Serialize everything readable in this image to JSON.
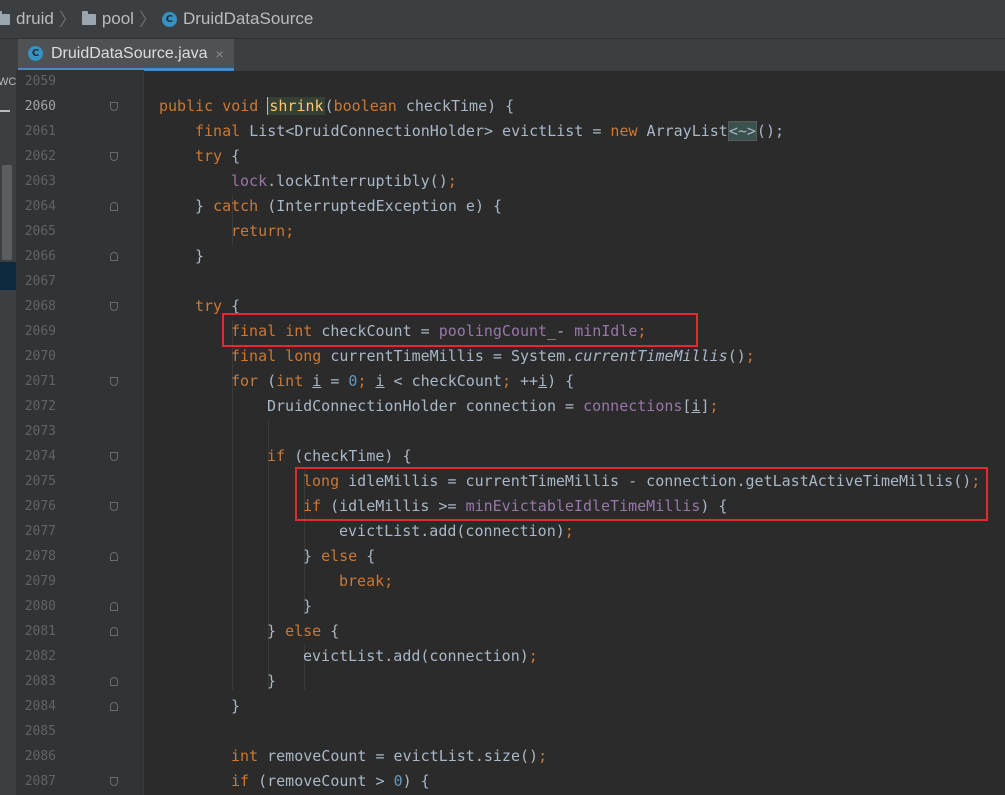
{
  "breadcrumb": {
    "items": [
      "druid",
      "pool",
      "DruidDataSource"
    ]
  },
  "tab": {
    "label": "DruidDataSource.java",
    "close": "×"
  },
  "side": {
    "label": "WC"
  },
  "icons": {
    "class_icon_letter": "C"
  },
  "colors": {
    "keyword": "#cc7832",
    "field": "#9876aa",
    "number": "#6897bb",
    "method_decl": "#ffc66d",
    "text": "#a9b7c6",
    "highlight_box": "#e02c2c",
    "background": "#2b2b2b"
  },
  "editor": {
    "current_line": "2060",
    "lines": [
      {
        "num": "2059",
        "t": []
      },
      {
        "num": "2060",
        "t": [
          [
            "kw",
            "public "
          ],
          [
            "kw",
            "void "
          ],
          [
            "fn",
            "shrink"
          ],
          [
            "",
            "("
          ],
          [
            "kw",
            "boolean "
          ],
          [
            "",
            "checkTime) {"
          ]
        ]
      },
      {
        "num": "2061",
        "t": [
          [
            "kw",
            "final "
          ],
          [
            "",
            "List<DruidConnectionHolder> evictList = "
          ],
          [
            "kw",
            "new "
          ],
          [
            "",
            "ArrayList"
          ],
          [
            "fold",
            "<~>"
          ],
          [
            "",
            "();"
          ]
        ]
      },
      {
        "num": "2062",
        "t": [
          [
            "kw",
            "try "
          ],
          [
            "",
            "{"
          ]
        ]
      },
      {
        "num": "2063",
        "t": [
          [
            "fld",
            "lock"
          ],
          [
            "",
            ".lockInterruptibly()"
          ],
          [
            "kw",
            ";"
          ]
        ]
      },
      {
        "num": "2064",
        "t": [
          [
            "",
            "} "
          ],
          [
            "kw",
            "catch "
          ],
          [
            "",
            "(InterruptedException e) {"
          ]
        ]
      },
      {
        "num": "2065",
        "t": [
          [
            "kw",
            "return;"
          ]
        ]
      },
      {
        "num": "2066",
        "t": [
          [
            "",
            "}"
          ]
        ]
      },
      {
        "num": "2067",
        "t": []
      },
      {
        "num": "2068",
        "t": [
          [
            "kw",
            "try "
          ],
          [
            "",
            "{"
          ]
        ]
      },
      {
        "num": "2069",
        "t": [
          [
            "kw",
            "final "
          ],
          [
            "kw",
            "int "
          ],
          [
            "",
            "checkCount = "
          ],
          [
            "fld",
            "poolingCount"
          ],
          [
            "",
            "_- "
          ],
          [
            "fld",
            "minIdle"
          ],
          [
            "kw",
            ";"
          ]
        ]
      },
      {
        "num": "2070",
        "t": [
          [
            "kw",
            "final "
          ],
          [
            "kw",
            "long "
          ],
          [
            "",
            "currentTimeMillis = System."
          ],
          [
            "it",
            "currentTimeMillis"
          ],
          [
            "",
            "()"
          ],
          [
            "kw",
            ";"
          ]
        ]
      },
      {
        "num": "2071",
        "t": [
          [
            "kw",
            "for "
          ],
          [
            "",
            "("
          ],
          [
            "kw",
            "int "
          ],
          [
            "ul",
            "i"
          ],
          [
            "",
            " = "
          ],
          [
            "num",
            "0"
          ],
          [
            "kw",
            "; "
          ],
          [
            "ul",
            "i"
          ],
          [
            "",
            "",
            " < checkCount"
          ],
          [
            "kw",
            "; "
          ],
          [
            "",
            "++"
          ],
          [
            "ul",
            "i"
          ],
          [
            "",
            ") {"
          ]
        ]
      },
      {
        "num": "2072",
        "t": [
          [
            "",
            "DruidConnectionHolder connection = "
          ],
          [
            "fld",
            "connections"
          ],
          [
            "",
            "["
          ],
          [
            "ul",
            "i"
          ],
          [
            "",
            "]"
          ],
          [
            "kw",
            ";"
          ]
        ]
      },
      {
        "num": "2073",
        "t": []
      },
      {
        "num": "2074",
        "t": [
          [
            "kw",
            "if "
          ],
          [
            "",
            "(checkTime) {"
          ]
        ]
      },
      {
        "num": "2075",
        "t": [
          [
            "kw",
            "long "
          ],
          [
            "",
            "idleMillis = currentTimeMillis - connection.getLastActiveTimeMillis()"
          ],
          [
            "kw",
            ";"
          ]
        ]
      },
      {
        "num": "2076",
        "t": [
          [
            "kw",
            "if "
          ],
          [
            "",
            "(idleMillis >= "
          ],
          [
            "fld",
            "minEvictableIdleTimeMillis"
          ],
          [
            "",
            ") {"
          ]
        ]
      },
      {
        "num": "2077",
        "t": [
          [
            "",
            "evictList.add(connection)"
          ],
          [
            "kw",
            ";"
          ]
        ]
      },
      {
        "num": "2078",
        "t": [
          [
            "",
            "} "
          ],
          [
            "kw",
            "else "
          ],
          [
            "",
            "{"
          ]
        ]
      },
      {
        "num": "2079",
        "t": [
          [
            "kw",
            "break;"
          ]
        ]
      },
      {
        "num": "2080",
        "t": [
          [
            "",
            "}"
          ]
        ]
      },
      {
        "num": "2081",
        "t": [
          [
            "",
            "} "
          ],
          [
            "kw",
            "else "
          ],
          [
            "",
            "{"
          ]
        ]
      },
      {
        "num": "2082",
        "t": [
          [
            "",
            "evictList.add(connection)"
          ],
          [
            "kw",
            ";"
          ]
        ]
      },
      {
        "num": "2083",
        "t": [
          [
            "",
            "}"
          ]
        ]
      },
      {
        "num": "2084",
        "t": [
          [
            "",
            "}"
          ]
        ]
      },
      {
        "num": "2085",
        "t": []
      },
      {
        "num": "2086",
        "t": [
          [
            "kw",
            "int "
          ],
          [
            "",
            "removeCount = evictList.size()"
          ],
          [
            "kw",
            ";"
          ]
        ]
      },
      {
        "num": "2087",
        "t": [
          [
            "kw",
            "if "
          ],
          [
            "",
            "(removeCount > "
          ],
          [
            "num",
            "0"
          ],
          [
            "",
            ") {"
          ]
        ]
      }
    ]
  }
}
